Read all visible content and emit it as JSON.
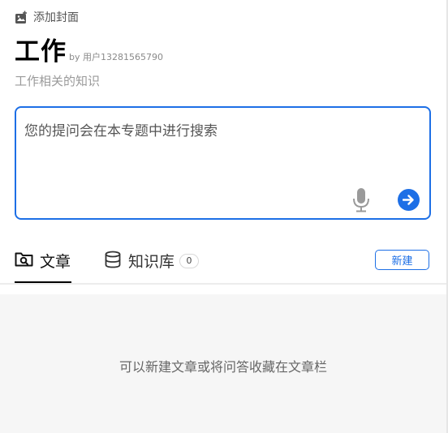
{
  "cover": {
    "label": "添加封面",
    "icon": "image-add-icon"
  },
  "topic": {
    "title": "工作",
    "by": "by 用户13281565790",
    "description": "工作相关的知识"
  },
  "prompt": {
    "placeholder": "您的提问会在本专题中进行搜索",
    "value": ""
  },
  "tabs": {
    "articles": {
      "label": "文章",
      "icon": "search-folder-icon",
      "active": true
    },
    "knowledge_base": {
      "label": "知识库",
      "icon": "database-icon",
      "count": "0"
    }
  },
  "actions": {
    "new_label": "新建"
  },
  "empty_state": {
    "message": "可以新建文章或将问答收藏在文章栏"
  },
  "colors": {
    "accent": "#1d6fe6",
    "muted_text": "#9a9a9a",
    "panel_bg": "#f6f6f6"
  }
}
